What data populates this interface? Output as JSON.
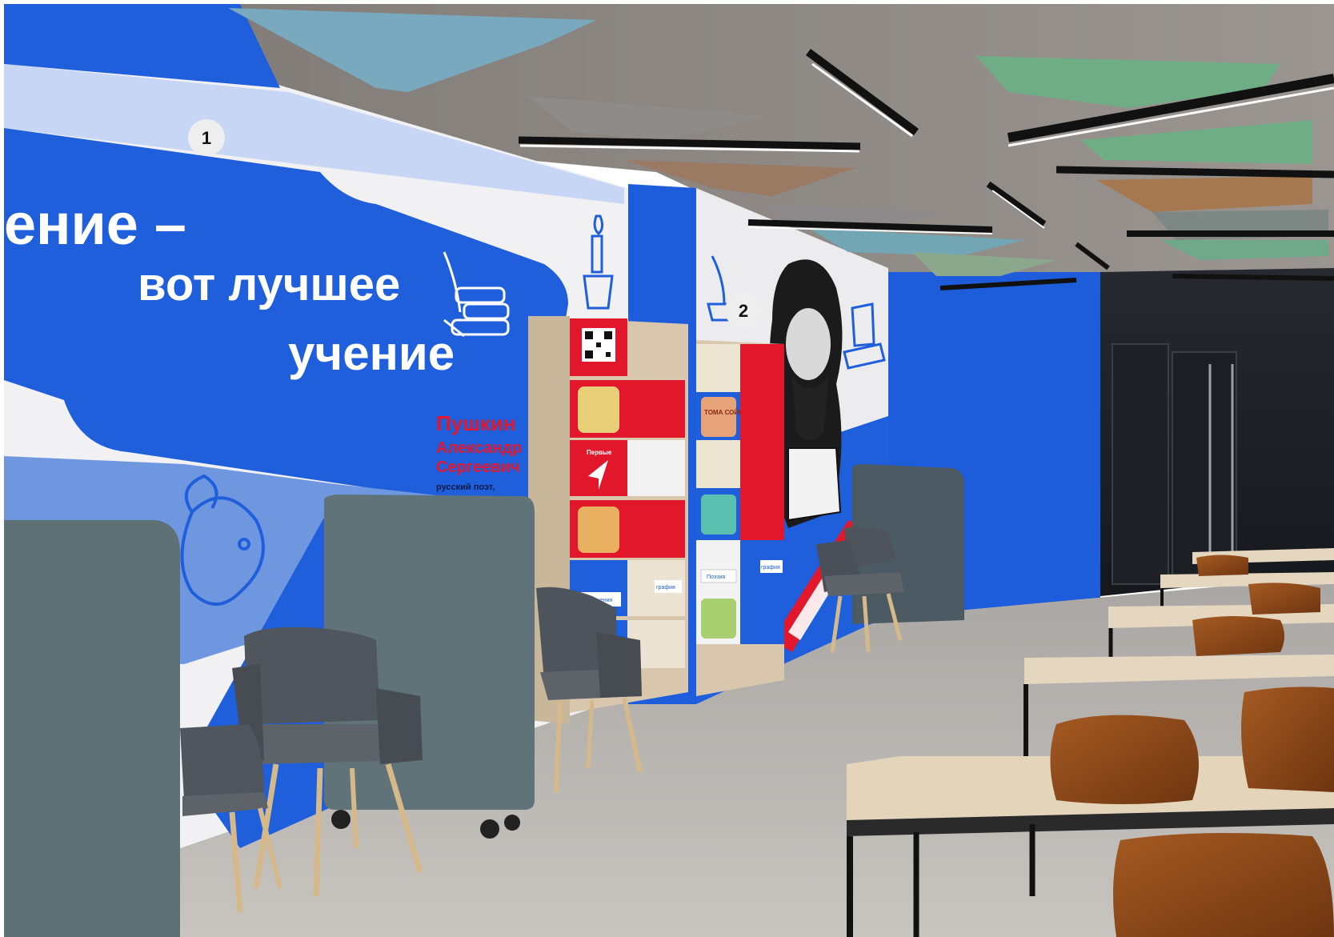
{
  "markers": [
    {
      "label": "1"
    },
    {
      "label": "2"
    }
  ],
  "wall_slogan": {
    "line1": "ение –",
    "line2": "вот лучшее",
    "line3": "учение"
  },
  "signature": {
    "surname": "Пушкин",
    "name": "Александр",
    "patronymic": "Сергеевич",
    "role": "русский поэт,"
  },
  "shelf_labels": {
    "red_panel": "Первые",
    "blue_panel_left": "Приключения",
    "blue_panel_right": "Поэзия",
    "cream_tag_1": "графия",
    "cream_tag_2": "графия"
  },
  "book_cover_text": "ТОМА СОЙЕРА",
  "colors": {
    "wall_blue": "#1f5fdc",
    "accent_red": "#e2172c",
    "light_blue": "#6f97e0",
    "ceiling": "#8a8581",
    "floor": "#b9b5b1",
    "seat_grey": "#5b6066"
  }
}
